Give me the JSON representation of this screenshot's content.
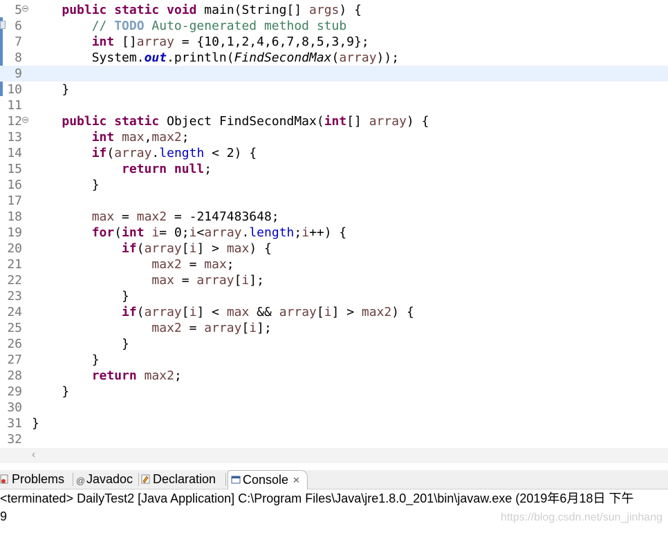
{
  "editor": {
    "current_line": 9,
    "lines": [
      {
        "n": "5",
        "fold": true
      },
      {
        "n": "6"
      },
      {
        "n": "7"
      },
      {
        "n": "8"
      },
      {
        "n": "9"
      },
      {
        "n": "10"
      },
      {
        "n": "11"
      },
      {
        "n": "12",
        "fold": true
      },
      {
        "n": "13"
      },
      {
        "n": "14"
      },
      {
        "n": "15"
      },
      {
        "n": "16"
      },
      {
        "n": "17"
      },
      {
        "n": "18"
      },
      {
        "n": "19"
      },
      {
        "n": "20"
      },
      {
        "n": "21"
      },
      {
        "n": "22"
      },
      {
        "n": "23"
      },
      {
        "n": "24"
      },
      {
        "n": "25"
      },
      {
        "n": "26"
      },
      {
        "n": "27"
      },
      {
        "n": "28"
      },
      {
        "n": "29"
      },
      {
        "n": "30"
      },
      {
        "n": "31"
      },
      {
        "n": "32"
      }
    ],
    "code": [
      [
        [
          "    ",
          ""
        ],
        [
          "public",
          "kw"
        ],
        [
          " ",
          ""
        ],
        [
          "static",
          "kw"
        ],
        [
          " ",
          ""
        ],
        [
          "void",
          "kw"
        ],
        [
          " main(String[] ",
          ""
        ],
        [
          "args",
          "var"
        ],
        [
          ") {",
          ""
        ]
      ],
      [
        [
          "        ",
          ""
        ],
        [
          "// ",
          "cm"
        ],
        [
          "TODO",
          "todo"
        ],
        [
          " Auto-generated method stub",
          "cm"
        ]
      ],
      [
        [
          "        ",
          ""
        ],
        [
          "int",
          "kw"
        ],
        [
          " []",
          ""
        ],
        [
          "array",
          "var"
        ],
        [
          " = {10,1,2,4,6,7,8,5,3,9};",
          ""
        ]
      ],
      [
        [
          "        System.",
          ""
        ],
        [
          "out",
          "sfld"
        ],
        [
          ".println(",
          ""
        ],
        [
          "FindSecondMax",
          "meth"
        ],
        [
          "(",
          ""
        ],
        [
          "array",
          "var"
        ],
        [
          "));",
          ""
        ]
      ],
      [],
      [
        [
          "    }",
          ""
        ]
      ],
      [],
      [
        [
          "    ",
          ""
        ],
        [
          "public",
          "kw"
        ],
        [
          " ",
          ""
        ],
        [
          "static",
          "kw"
        ],
        [
          " Object FindSecondMax(",
          ""
        ],
        [
          "int",
          "kw"
        ],
        [
          "[] ",
          ""
        ],
        [
          "array",
          "var"
        ],
        [
          ") {",
          ""
        ]
      ],
      [
        [
          "        ",
          ""
        ],
        [
          "int",
          "kw"
        ],
        [
          " ",
          ""
        ],
        [
          "max",
          "var"
        ],
        [
          ",",
          ""
        ],
        [
          "max2",
          "var"
        ],
        [
          ";",
          ""
        ]
      ],
      [
        [
          "        ",
          ""
        ],
        [
          "if",
          "kw"
        ],
        [
          "(",
          ""
        ],
        [
          "array",
          "var"
        ],
        [
          ".",
          ""
        ],
        [
          "length",
          "fld"
        ],
        [
          " < 2) {",
          ""
        ]
      ],
      [
        [
          "            ",
          ""
        ],
        [
          "return",
          "kw"
        ],
        [
          " ",
          ""
        ],
        [
          "null",
          "kw"
        ],
        [
          ";",
          ""
        ]
      ],
      [
        [
          "        }",
          ""
        ]
      ],
      [],
      [
        [
          "        ",
          ""
        ],
        [
          "max",
          "var"
        ],
        [
          " = ",
          ""
        ],
        [
          "max2",
          "var"
        ],
        [
          " = -2147483648;",
          ""
        ]
      ],
      [
        [
          "        ",
          ""
        ],
        [
          "for",
          "kw"
        ],
        [
          "(",
          ""
        ],
        [
          "int",
          "kw"
        ],
        [
          " ",
          ""
        ],
        [
          "i",
          "var"
        ],
        [
          "= 0;",
          ""
        ],
        [
          "i",
          "var"
        ],
        [
          "<",
          ""
        ],
        [
          "array",
          "var"
        ],
        [
          ".",
          ""
        ],
        [
          "length",
          "fld"
        ],
        [
          ";",
          ""
        ],
        [
          "i",
          "var"
        ],
        [
          "++) {",
          ""
        ]
      ],
      [
        [
          "            ",
          ""
        ],
        [
          "if",
          "kw"
        ],
        [
          "(",
          ""
        ],
        [
          "array",
          "var"
        ],
        [
          "[",
          ""
        ],
        [
          "i",
          "var"
        ],
        [
          "] > ",
          ""
        ],
        [
          "max",
          "var"
        ],
        [
          ") {",
          ""
        ]
      ],
      [
        [
          "                ",
          ""
        ],
        [
          "max2",
          "var"
        ],
        [
          " = ",
          ""
        ],
        [
          "max",
          "var"
        ],
        [
          ";",
          ""
        ]
      ],
      [
        [
          "                ",
          ""
        ],
        [
          "max",
          "var"
        ],
        [
          " = ",
          ""
        ],
        [
          "array",
          "var"
        ],
        [
          "[",
          ""
        ],
        [
          "i",
          "var"
        ],
        [
          "];",
          ""
        ]
      ],
      [
        [
          "            }",
          ""
        ]
      ],
      [
        [
          "            ",
          ""
        ],
        [
          "if",
          "kw"
        ],
        [
          "(",
          ""
        ],
        [
          "array",
          "var"
        ],
        [
          "[",
          ""
        ],
        [
          "i",
          "var"
        ],
        [
          "] < ",
          ""
        ],
        [
          "max",
          "var"
        ],
        [
          " && ",
          ""
        ],
        [
          "array",
          "var"
        ],
        [
          "[",
          ""
        ],
        [
          "i",
          "var"
        ],
        [
          "] > ",
          ""
        ],
        [
          "max2",
          "var"
        ],
        [
          ") {",
          ""
        ]
      ],
      [
        [
          "                ",
          ""
        ],
        [
          "max2",
          "var"
        ],
        [
          " = ",
          ""
        ],
        [
          "array",
          "var"
        ],
        [
          "[",
          ""
        ],
        [
          "i",
          "var"
        ],
        [
          "];",
          ""
        ]
      ],
      [
        [
          "            }",
          ""
        ]
      ],
      [
        [
          "        }",
          ""
        ]
      ],
      [
        [
          "        ",
          ""
        ],
        [
          "return",
          "kw"
        ],
        [
          " ",
          ""
        ],
        [
          "max2",
          "var"
        ],
        [
          ";",
          ""
        ]
      ],
      [
        [
          "    }",
          ""
        ]
      ],
      [],
      [
        [
          "}",
          ""
        ]
      ],
      []
    ]
  },
  "console": {
    "tabs": [
      {
        "label": "Problems",
        "icon": "problems-icon"
      },
      {
        "label": "Javadoc",
        "icon": "javadoc-icon"
      },
      {
        "label": "Declaration",
        "icon": "declaration-icon"
      },
      {
        "label": "Console",
        "icon": "console-icon",
        "active": true
      }
    ],
    "close_glyph": "✕",
    "status": "<terminated> DailyTest2 [Java Application] C:\\Program Files\\Java\\jre1.8.0_201\\bin\\javaw.exe (2019年6月18日 下午",
    "output": "9"
  },
  "watermark": "https://blog.csdn.net/sun_jinhang",
  "colors": {
    "keyword": "#7f0055",
    "comment": "#3f7f5f",
    "field": "#0000c0",
    "local_var": "#6a3e3e",
    "current_line_bg": "#e8f2fe"
  }
}
